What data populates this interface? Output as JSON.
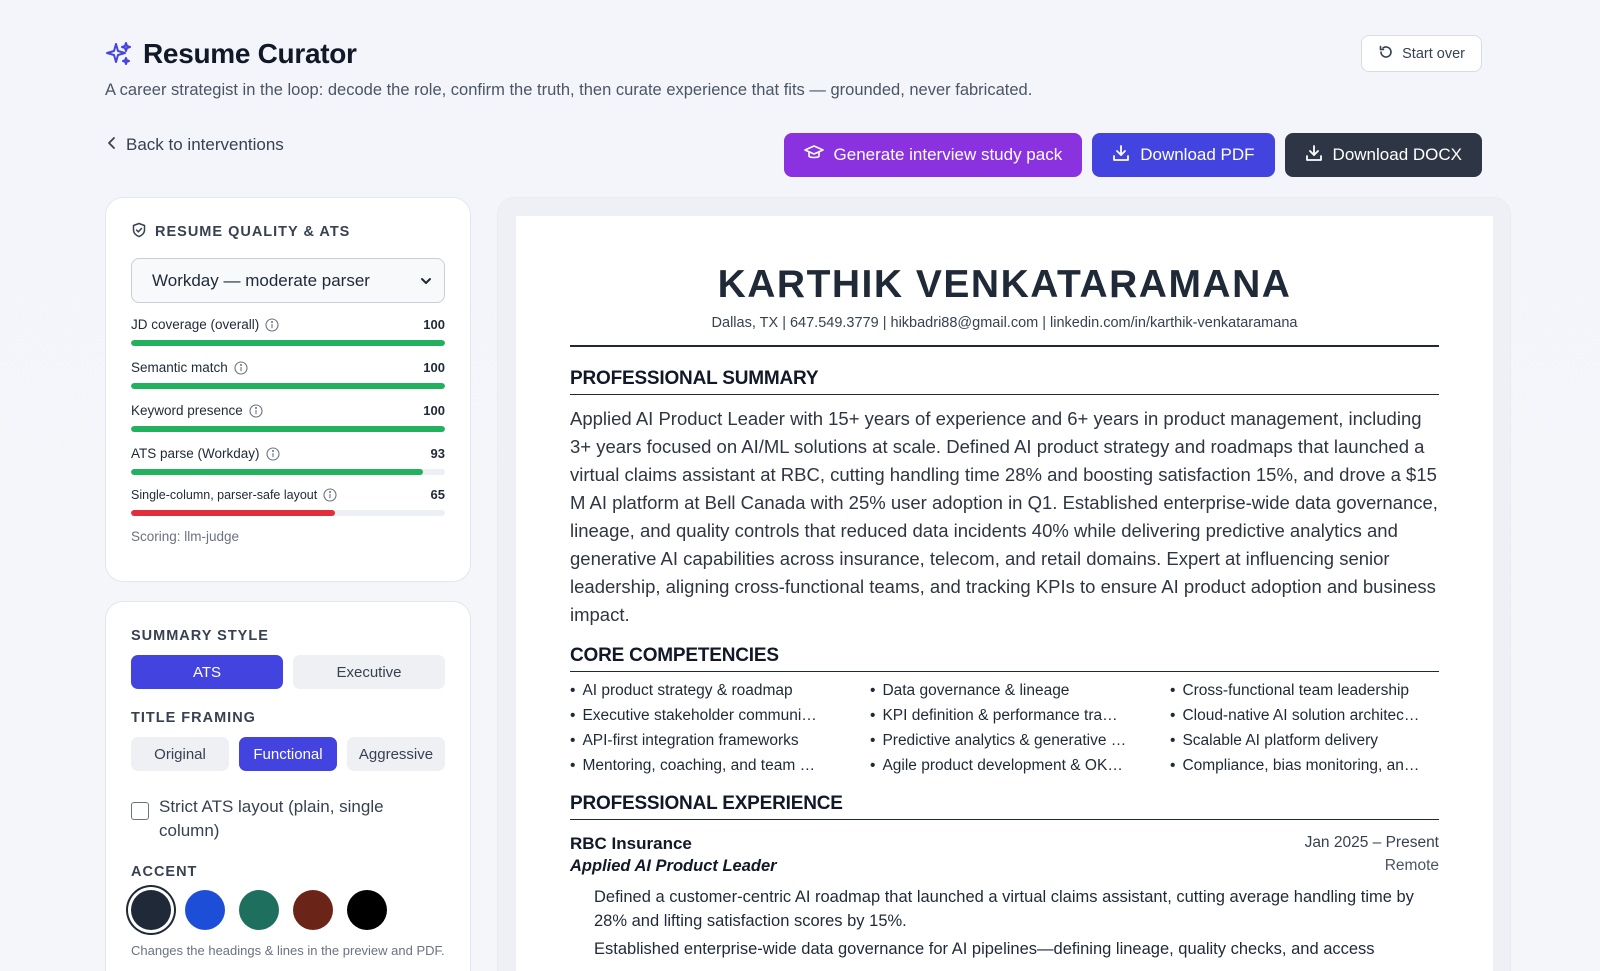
{
  "app": {
    "title": "Resume Curator",
    "tagline": "A career strategist in the loop: decode the role, confirm the truth, then curate experience that fits — grounded, never fabricated.",
    "start_over": "Start over",
    "back": "Back to interventions"
  },
  "actions": {
    "study_pack": "Generate interview study pack",
    "pdf": "Download PDF",
    "docx": "Download DOCX"
  },
  "quality": {
    "heading": "RESUME QUALITY & ATS",
    "parser_select": "Workday — moderate parser",
    "metrics": [
      {
        "label": "JD coverage (overall)",
        "value": 100,
        "color": "#22b15e"
      },
      {
        "label": "Semantic match",
        "value": 100,
        "color": "#22b15e"
      },
      {
        "label": "Keyword presence",
        "value": 100,
        "color": "#22b15e"
      },
      {
        "label": "ATS parse (Workday)",
        "value": 93,
        "color": "#22b15e"
      },
      {
        "label": "Single-column, parser-safe layout",
        "value": 65,
        "color": "#e02f3a"
      }
    ],
    "scoring": "Scoring: llm-judge"
  },
  "style": {
    "summary_label": "SUMMARY STYLE",
    "summary_options": [
      "ATS",
      "Executive"
    ],
    "summary_selected": "ATS",
    "title_label": "TITLE FRAMING",
    "title_options": [
      "Original",
      "Functional",
      "Aggressive"
    ],
    "title_selected": "Functional",
    "strict_label": "Strict ATS layout (plain, single column)",
    "strict_checked": false,
    "accent_label": "ACCENT",
    "accent_colors": [
      "#1f2937",
      "#1d4ed8",
      "#1f6f5f",
      "#6b2418",
      "#000000"
    ],
    "accent_selected": 0,
    "accent_note": "Changes the headings & lines in the preview and PDF."
  },
  "resume": {
    "name": "KARTHIK VENKATARAMANA",
    "contact": "Dallas, TX | 647.549.3779 | hikbadri88@gmail.com | linkedin.com/in/karthik-venkataramana",
    "summary_heading": "PROFESSIONAL SUMMARY",
    "summary": "Applied AI Product Leader with 15+ years of experience and 6+ years in product management, including 3+ years focused on AI/ML solutions at scale. Defined AI product strategy and roadmaps that launched a virtual claims assistant at RBC, cutting handling time 28% and boosting satisfaction 15%, and drove a $15 M AI platform at Bell Canada with 25% user adoption in Q1. Established enterprise-wide data governance, lineage, and quality controls that reduced data incidents 40% while delivering predictive analytics and generative AI capabilities across insurance, telecom, and retail domains. Expert at influencing senior leadership, aligning cross-functional teams, and tracking KPIs to ensure AI product adoption and business impact.",
    "competencies_heading": "CORE COMPETENCIES",
    "competencies": [
      "AI product strategy & roadmap",
      "Data governance & lineage",
      "Cross-functional team leadership",
      "Executive stakeholder communi…",
      "KPI definition & performance tra…",
      "Cloud-native AI solution architec…",
      "API-first integration frameworks",
      "Predictive analytics & generative …",
      "Scalable AI platform delivery",
      "Mentoring, coaching, and team …",
      "Agile product development & OK…",
      "Compliance, bias monitoring, an…"
    ],
    "experience_heading": "PROFESSIONAL EXPERIENCE",
    "job": {
      "company": "RBC Insurance",
      "dates": "Jan 2025 – Present",
      "title": "Applied AI Product Leader",
      "location": "Remote",
      "bullets": [
        "Defined a customer-centric AI roadmap that launched a virtual claims assistant, cutting average handling time by 28% and lifting satisfaction scores by 15%.",
        "Established enterprise-wide data governance for AI pipelines—defining lineage, quality checks, and access"
      ]
    }
  }
}
